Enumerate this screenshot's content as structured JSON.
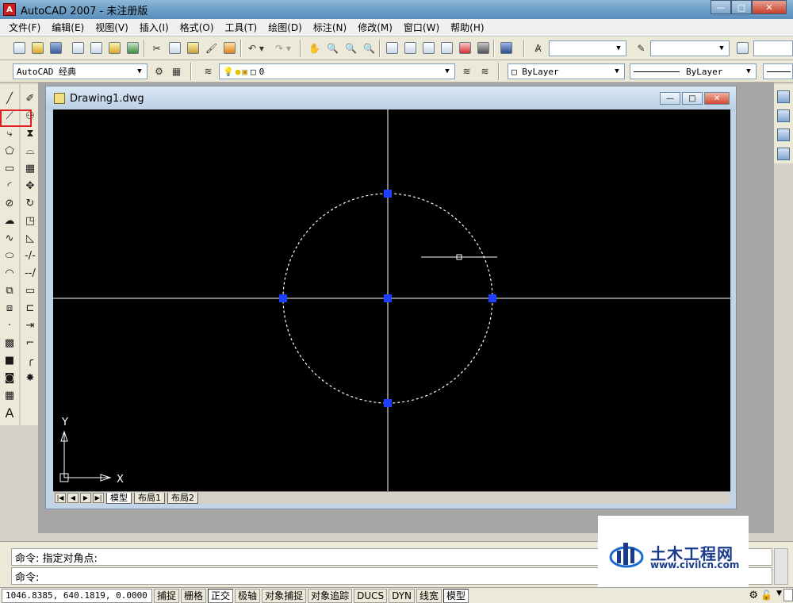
{
  "window": {
    "title": "AutoCAD 2007 - 未注册版",
    "icon": "autocad-logo-icon"
  },
  "menu": [
    "文件(F)",
    "编辑(E)",
    "视图(V)",
    "插入(I)",
    "格式(O)",
    "工具(T)",
    "绘图(D)",
    "标注(N)",
    "修改(M)",
    "窗口(W)",
    "帮助(H)"
  ],
  "toolbar2": {
    "workspace": "AutoCAD 经典",
    "layer": "0",
    "color": "ByLayer",
    "linetype": "ByLayer"
  },
  "drawing_window": {
    "title": "Drawing1.dwg",
    "tabs": [
      "模型",
      "布局1",
      "布局2"
    ],
    "active_tab": 0
  },
  "ucs": {
    "x_label": "X",
    "y_label": "Y"
  },
  "command": {
    "history": "命令: 指定对角点:",
    "prompt": "命令:"
  },
  "status": {
    "coords": "1046.8385, 640.1819, 0.0000",
    "buttons": [
      "捕捉",
      "栅格",
      "正交",
      "极轴",
      "对象捕捉",
      "对象追踪",
      "DUCS",
      "DYN",
      "线宽",
      "模型"
    ],
    "active_buttons": [
      "正交",
      "模型"
    ]
  },
  "watermark": {
    "name": "土木工程网",
    "url": "www.civilcn.com"
  },
  "colors": {
    "canvas": "#000000",
    "grip": "#1f3fff",
    "highlight": "#e02020"
  }
}
